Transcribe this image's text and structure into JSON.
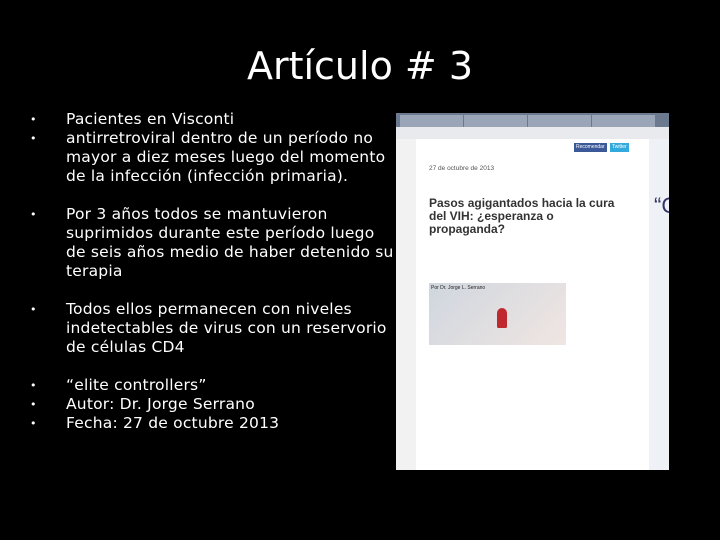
{
  "slide": {
    "title": "Artículo # 3",
    "bullets": [
      "Pacientes en  Visconti",
      "antirretroviral dentro de un período no mayor a diez meses luego del momento de la infección (infección primaria).",
      " Por 3 años todos se mantuvieron  suprimidos durante este período luego de seis años medio de haber detenido su terapia",
      "Todos ellos permanecen con niveles indetectables de virus con un reservorio de células CD4",
      " “elite controllers”",
      "Autor: Dr. Jorge Serrano",
      "Fecha: 27 de octubre 2013"
    ],
    "bullet_glyph": "•"
  },
  "screenshot": {
    "date": "27 de octubre de 2013",
    "headline": "Pasos agigantados hacia la cura del VIH: ¿esperanza o propaganda?",
    "author": "Por Dr. Jorge L. Serrano",
    "share_recommend": "Recomendar",
    "share_twitter": "Twitter",
    "quote_mark": "“C"
  }
}
